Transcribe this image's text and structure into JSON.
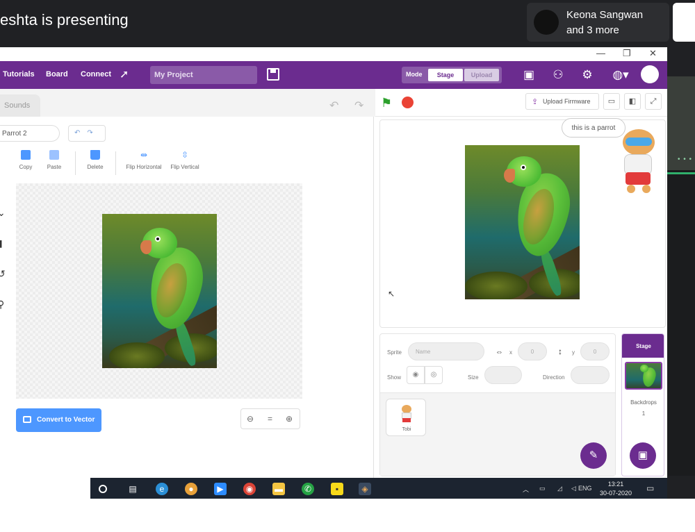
{
  "meeting": {
    "presenting_text": "eshta is presenting",
    "participants": [
      "Keona Sangwan",
      "and 3 more"
    ]
  },
  "window": {
    "controls": [
      "—",
      "❐",
      "✕"
    ]
  },
  "menubar": {
    "items": [
      "Tutorials",
      "Board",
      "Connect"
    ],
    "project_name": "My Project",
    "mode_label": "Mode",
    "mode_stage": "Stage",
    "mode_upload": "Upload",
    "colors": {
      "purple": "#6b2c8f",
      "accent_blue": "#4d97ff",
      "stop_red": "#ea4335"
    }
  },
  "editor": {
    "tab_sounds": "Sounds",
    "costume_name": "Parrot 2",
    "tools": [
      "Copy",
      "Paste",
      "Delete",
      "Flip Horizontal",
      "Flip Vertical"
    ],
    "convert_button": "Convert to Vector"
  },
  "stage": {
    "upload_firmware": "Upload Firmware",
    "speech_bubble": "this is a parrot"
  },
  "sprite": {
    "sprite_label": "Sprite",
    "name_placeholder": "Name",
    "x_label": "x",
    "x_value": "0",
    "y_label": "y",
    "y_value": "0",
    "show_label": "Show",
    "size_label": "Size",
    "direction_label": "Direction",
    "sprite_name": "Tobi"
  },
  "stage_panel": {
    "title": "Stage",
    "backdrops_label": "Backdrops",
    "backdrops_count": "1"
  },
  "taskbar": {
    "lang": "ENG",
    "time": "13:21",
    "date": "30-07-2020"
  }
}
